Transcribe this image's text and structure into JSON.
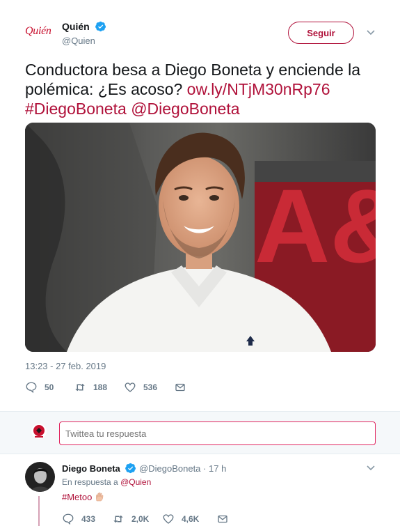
{
  "tweet": {
    "logo_text": "Quién",
    "author_name": "Quién",
    "author_handle": "@Quien",
    "follow_label": "Seguir",
    "text_plain": "Conductora besa a Diego Boneta y enciende la polémica: ¿Es acoso? ",
    "text_link": "ow.ly/NTjM30nRp76",
    "hashtag": "#DiegoBoneta",
    "mention": "@DiegoBoneta",
    "image_store_letters": "A&E",
    "timestamp": "13:23 - 27 feb. 2019",
    "actions": {
      "replies": "50",
      "retweets": "188",
      "likes": "536"
    }
  },
  "reply_box": {
    "placeholder": "Twittea tu respuesta"
  },
  "reply": {
    "author_name": "Diego Boneta",
    "author_handle": "@DiegoBoneta",
    "separator": "·",
    "time": "17 h",
    "replying_prefix": "En respuesta a ",
    "replying_to": "@Quien",
    "body": "#Metoo",
    "actions": {
      "replies": "433",
      "retweets": "2,0K",
      "likes": "4,6K"
    }
  },
  "colors": {
    "accent": "#b0113a",
    "verified": "#1da1f2",
    "muted": "#657786",
    "text": "#14171a",
    "reply_area_bg": "#f5f8fa"
  },
  "icons": {
    "verified": "verified-badge-icon",
    "more": "chevron-down-icon",
    "reply": "reply-icon",
    "retweet": "retweet-icon",
    "like": "heart-icon",
    "dm": "envelope-icon"
  }
}
